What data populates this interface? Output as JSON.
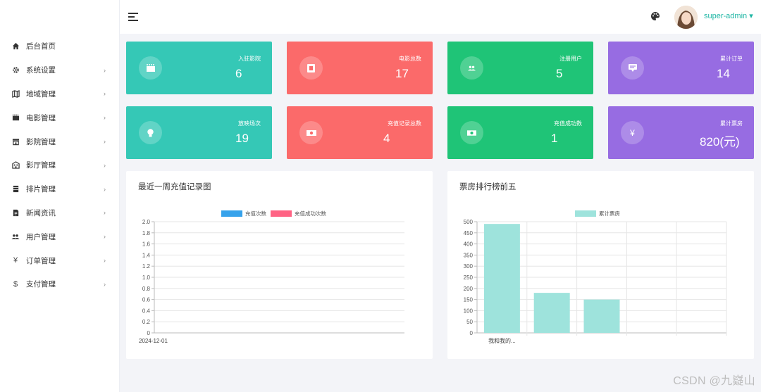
{
  "header": {
    "username": "super-admin ▾"
  },
  "sidebar": {
    "items": [
      {
        "label": "后台首页",
        "icon": "home-icon",
        "arrow": ""
      },
      {
        "label": "系统设置",
        "icon": "gear-icon",
        "arrow": "›"
      },
      {
        "label": "地域管理",
        "icon": "map-icon",
        "arrow": "›"
      },
      {
        "label": "电影管理",
        "icon": "film-icon",
        "arrow": "›"
      },
      {
        "label": "影院管理",
        "icon": "store-icon",
        "arrow": "›"
      },
      {
        "label": "影厅管理",
        "icon": "building-icon",
        "arrow": "›"
      },
      {
        "label": "排片管理",
        "icon": "calendar-icon",
        "arrow": "›"
      },
      {
        "label": "新闻资讯",
        "icon": "news-icon",
        "arrow": "›"
      },
      {
        "label": "用户管理",
        "icon": "users-icon",
        "arrow": "›"
      },
      {
        "label": "订单管理",
        "icon": "yen-icon",
        "arrow": "›"
      },
      {
        "label": "支付管理",
        "icon": "dollar-icon",
        "arrow": "›"
      }
    ]
  },
  "stats": [
    {
      "label": "入驻影院",
      "value": "6",
      "icon": "clapper-icon",
      "color": "#35c8b6"
    },
    {
      "label": "电影总数",
      "value": "17",
      "icon": "film-reel-icon",
      "color": "#fb6a6a"
    },
    {
      "label": "注册用户",
      "value": "5",
      "icon": "users-icon",
      "color": "#1fc477"
    },
    {
      "label": "累计订单",
      "value": "14",
      "icon": "order-icon",
      "color": "#976ce2"
    },
    {
      "label": "放映场次",
      "value": "19",
      "icon": "lightbulb-icon",
      "color": "#35c8b6"
    },
    {
      "label": "充值记录总数",
      "value": "4",
      "icon": "cash-icon",
      "color": "#fb6a6a"
    },
    {
      "label": "充值成功数",
      "value": "1",
      "icon": "money-icon",
      "color": "#1fc477"
    },
    {
      "label": "累计票房",
      "value": "820(元)",
      "icon": "yen-icon",
      "color": "#976ce2"
    }
  ],
  "panels": {
    "recharge_title": "最近一周充值记录图",
    "boxoffice_title": "票房排行榜前五"
  },
  "chart_data": [
    {
      "type": "bar",
      "title": "最近一周充值记录图",
      "categories": [
        "2024-12-01"
      ],
      "series": [
        {
          "name": "充值次数",
          "values": [
            0
          ],
          "color": "#36a2eb"
        },
        {
          "name": "充值成功次数",
          "values": [
            0
          ],
          "color": "#ff6384"
        }
      ],
      "ylim": [
        0,
        2.0
      ],
      "yticks": [
        "2.0",
        "1.8",
        "1.6",
        "1.4",
        "1.2",
        "1.0",
        "0.8",
        "0.6",
        "0.4",
        "0.2",
        "0"
      ],
      "legend": "top"
    },
    {
      "type": "bar",
      "title": "票房排行榜前五",
      "categories": [
        "我和我的...",
        "",
        "",
        "",
        ""
      ],
      "series": [
        {
          "name": "累计票房",
          "values": [
            490,
            180,
            150,
            0,
            0
          ],
          "color": "#9ee3dc"
        }
      ],
      "ylim": [
        0,
        500
      ],
      "yticks": [
        "500",
        "450",
        "400",
        "350",
        "300",
        "250",
        "200",
        "150",
        "100",
        "50",
        "0"
      ],
      "legend": "top"
    }
  ],
  "watermark": "CSDN @九嶷山"
}
